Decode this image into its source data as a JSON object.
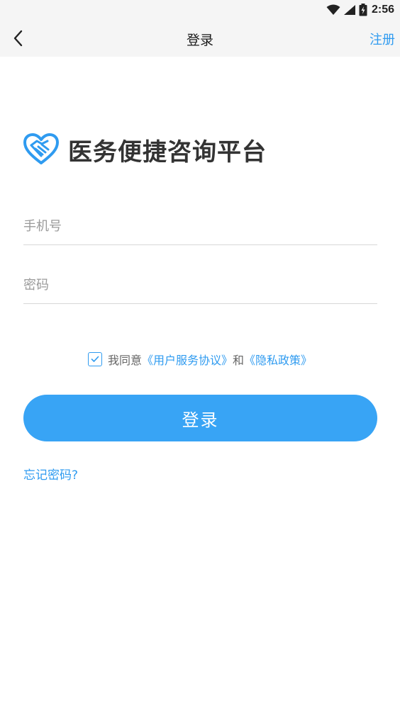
{
  "status_bar": {
    "time": "2:56",
    "icons": [
      "wifi-icon",
      "signal-icon",
      "battery-charging-icon"
    ]
  },
  "nav": {
    "back_icon": "chevron-left-icon",
    "title": "登录",
    "register_label": "注册"
  },
  "brand": {
    "logo_icon": "heart-handshake-icon",
    "name": "医务便捷咨询平台"
  },
  "form": {
    "phone_placeholder": "手机号",
    "phone_value": "",
    "password_placeholder": "密码",
    "password_value": ""
  },
  "agreement": {
    "checked": true,
    "prefix": "我同意",
    "user_agreement": "《用户服务协议》",
    "conjunction": "和",
    "privacy_policy": "《隐私政策》"
  },
  "login_button_label": "登录",
  "forgot_password_label": "忘记密码?",
  "colors": {
    "accent": "#2f9bf0",
    "button": "#38a4f5",
    "nav_background": "#f5f5f5",
    "text_dark": "#333333",
    "placeholder": "#9a9a9a"
  }
}
